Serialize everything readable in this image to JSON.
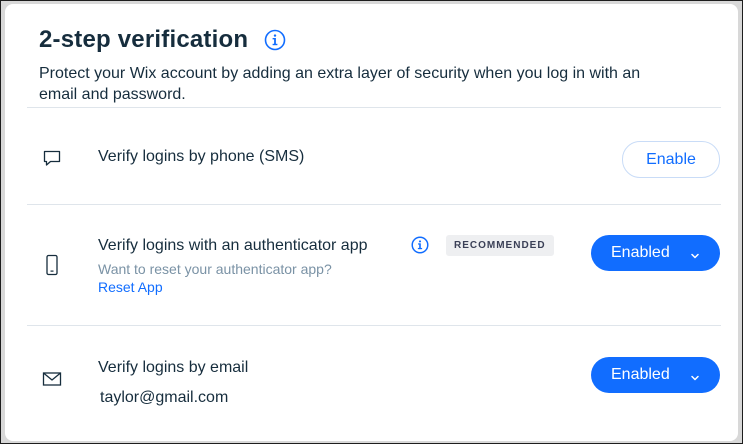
{
  "section": {
    "title": "2-step verification",
    "description": "Protect your Wix account by adding an extra layer of security when you log in with an email and password.",
    "title_icon": "info-circle-icon"
  },
  "methods": [
    {
      "icon": "chat-bubble-icon",
      "label": "Verify logins by phone (SMS)",
      "button_label": "Enable",
      "button_state": "disabled"
    },
    {
      "icon": "smartphone-icon",
      "label": "Verify logins with an authenticator app",
      "info_icon": "info-circle-icon",
      "badge": "RECOMMENDED",
      "sub_text": "Want to reset your authenticator app?",
      "link_label": "Reset App",
      "button_label": "Enabled",
      "button_state": "enabled"
    },
    {
      "icon": "envelope-icon",
      "label": "Verify logins by email",
      "value": "taylor@gmail.com",
      "button_label": "Enabled",
      "button_state": "enabled"
    }
  ],
  "colors": {
    "accent": "#116dff",
    "text": "#162d3d",
    "muted": "#7a92a5",
    "divider": "#dfe5eb"
  }
}
